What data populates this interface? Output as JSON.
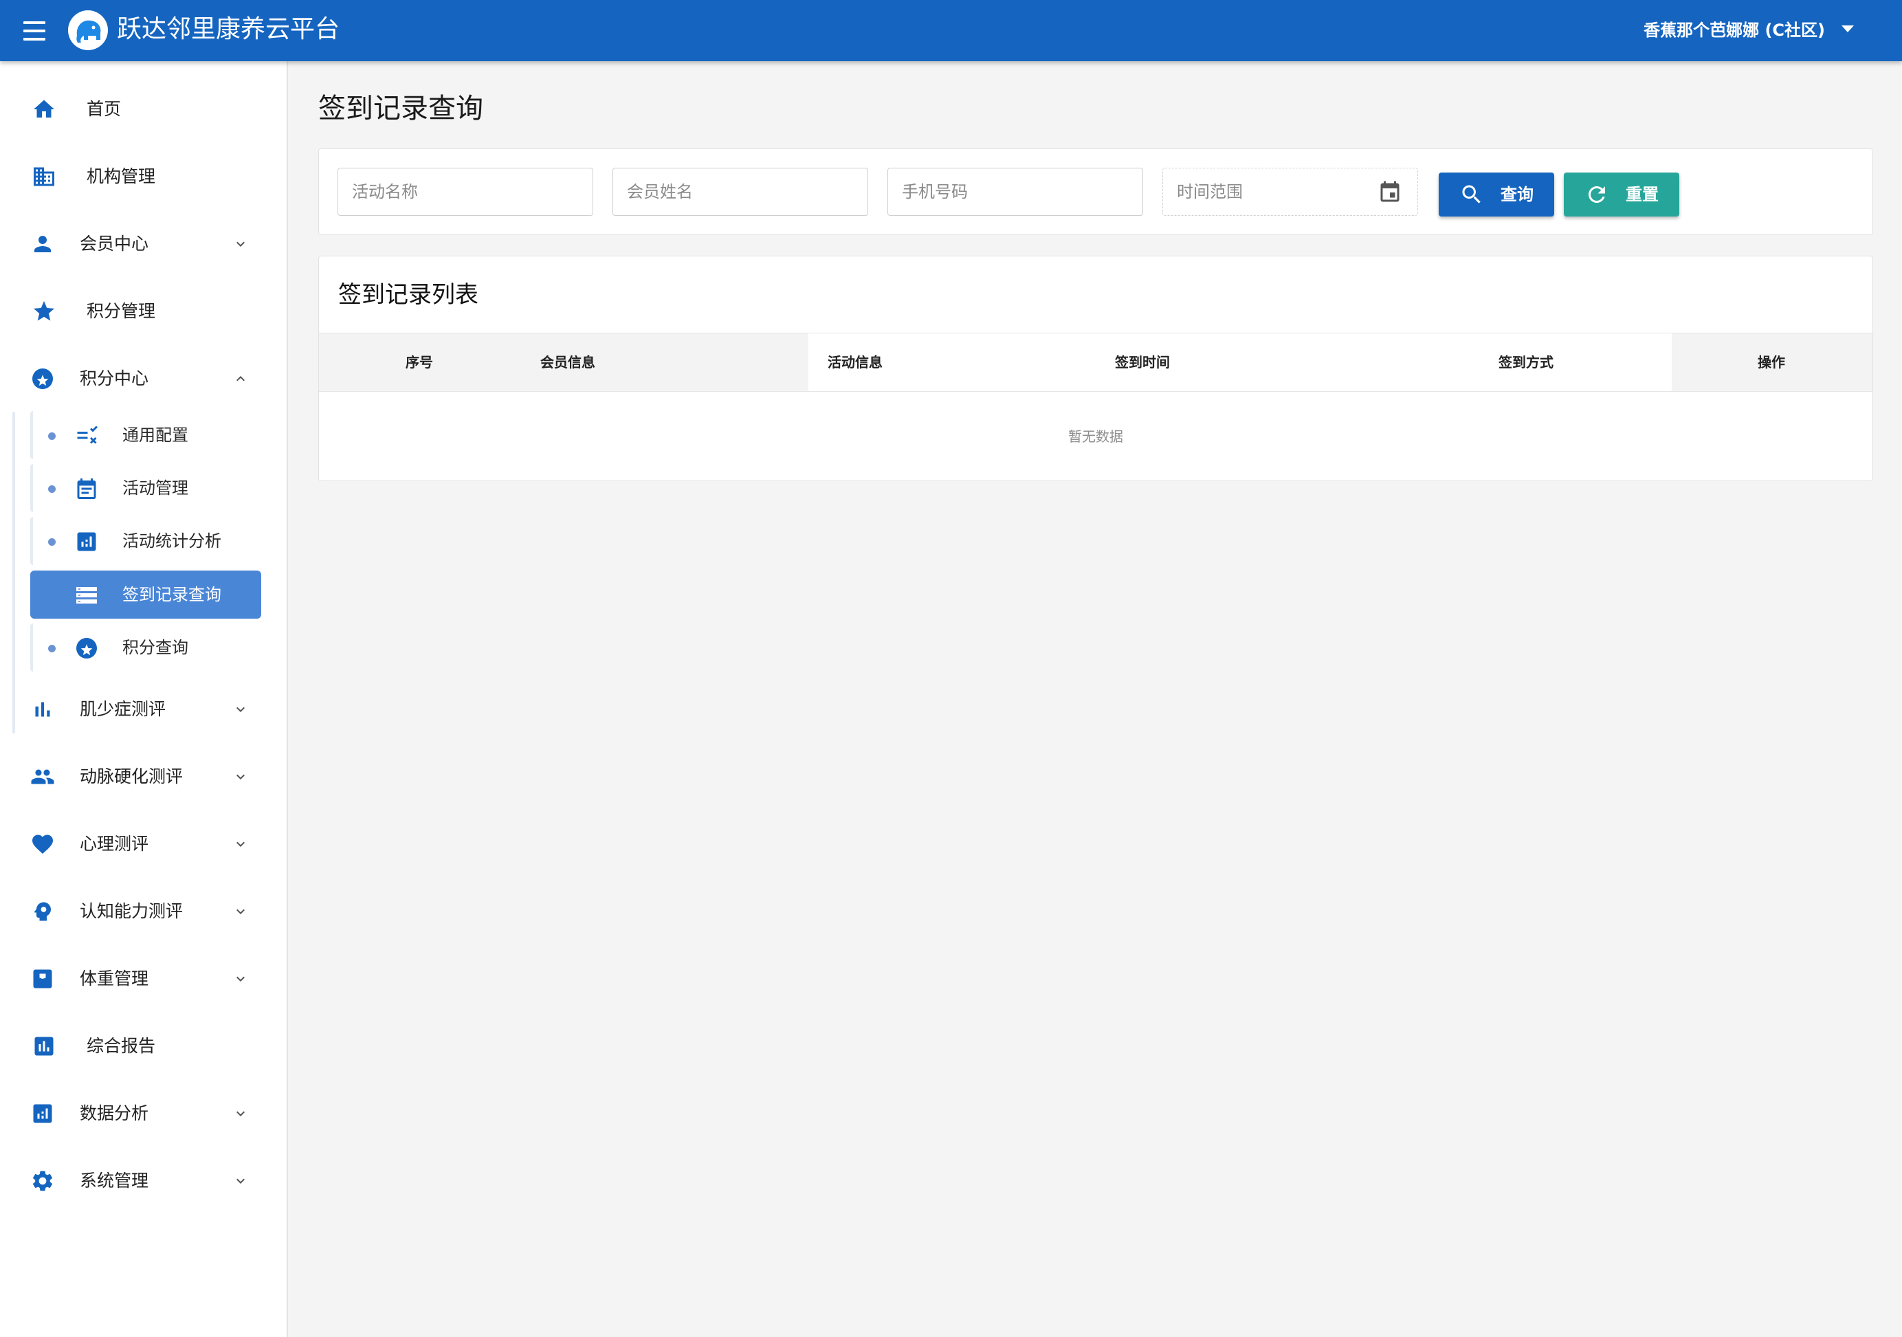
{
  "header": {
    "title": "跃达邻里康养云平台",
    "user": "香蕉那个芭娜娜 (C社区)"
  },
  "sidebar": {
    "items": [
      {
        "label": "首页",
        "icon": "home-icon"
      },
      {
        "label": "机构管理",
        "icon": "building-icon"
      },
      {
        "label": "会员中心",
        "icon": "person-icon",
        "expandable": true
      },
      {
        "label": "积分管理",
        "icon": "star-icon"
      },
      {
        "label": "积分中心",
        "icon": "star-circle-icon",
        "expanded": true
      },
      {
        "label": "肌少症测评",
        "icon": "bar-chart-icon",
        "expandable": true
      },
      {
        "label": "动脉硬化测评",
        "icon": "people-icon",
        "expandable": true
      },
      {
        "label": "心理测评",
        "icon": "heart-icon",
        "expandable": true
      },
      {
        "label": "认知能力测评",
        "icon": "brain-icon",
        "expandable": true
      },
      {
        "label": "体重管理",
        "icon": "scale-icon",
        "expandable": true
      },
      {
        "label": "综合报告",
        "icon": "report-icon"
      },
      {
        "label": "数据分析",
        "icon": "analytics-icon",
        "expandable": true
      },
      {
        "label": "系统管理",
        "icon": "gear-icon",
        "expandable": true
      }
    ],
    "sub_items": [
      {
        "label": "通用配置",
        "icon": "rule-icon"
      },
      {
        "label": "活动管理",
        "icon": "calendar-icon"
      },
      {
        "label": "活动统计分析",
        "icon": "stats-icon"
      },
      {
        "label": "签到记录查询",
        "icon": "list-icon",
        "active": true
      },
      {
        "label": "积分查询",
        "icon": "star-circle-icon"
      }
    ]
  },
  "page": {
    "title": "签到记录查询"
  },
  "filters": {
    "activity_name_placeholder": "活动名称",
    "member_name_placeholder": "会员姓名",
    "phone_placeholder": "手机号码",
    "time_range_placeholder": "时间范围",
    "search_label": "查询",
    "reset_label": "重置"
  },
  "table": {
    "title": "签到记录列表",
    "columns": [
      "序号",
      "会员信息",
      "活动信息",
      "签到时间",
      "签到方式",
      "操作"
    ],
    "empty_text": "暂无数据"
  },
  "colors": {
    "primary": "#1565c0",
    "accent": "#26a69a",
    "active_nav": "#4a86d6"
  }
}
